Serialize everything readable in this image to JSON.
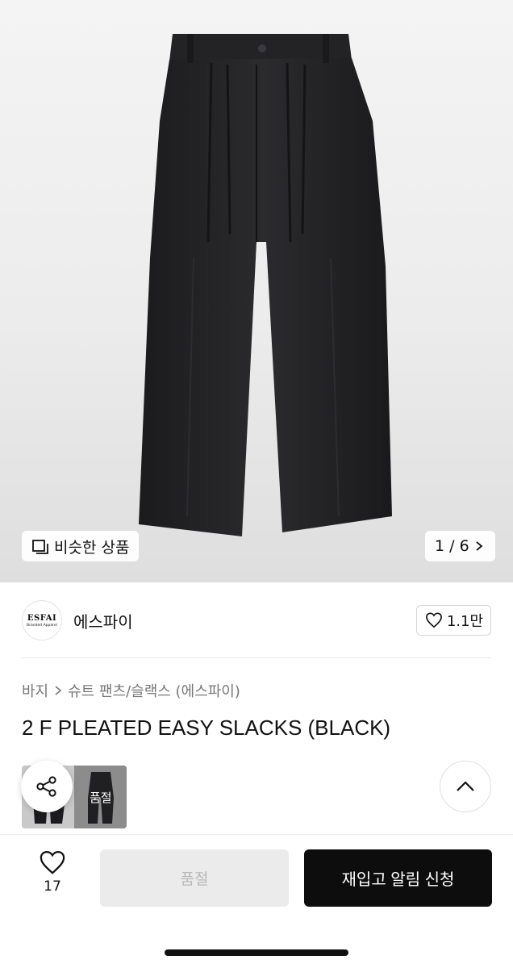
{
  "gallery": {
    "similar_label": "비슷한 상품",
    "pager": "1 / 6",
    "icons": {
      "similar": "similar-products-icon",
      "next": "chevron-right-icon"
    }
  },
  "seller": {
    "logo_line1": "ESFAI",
    "logo_line2": "Branded Apparel",
    "name": "에스파이",
    "likes": "1.1만"
  },
  "breadcrumb": {
    "level1": "바지",
    "level2": "슈트 팬츠/슬랙스 (에스파이)"
  },
  "product": {
    "title": "2 F PLEATED EASY SLACKS (BLACK)"
  },
  "thumbnails": {
    "second_label": "품절"
  },
  "bottom_bar": {
    "like_count": "17",
    "soldout_label": "품절",
    "restock_label": "재입고 알림 신청"
  },
  "colors": {
    "primary_button": "#0d0d0d",
    "disabled_button": "#ebebeb",
    "disabled_text": "#b8b8b8",
    "breadcrumb_text": "#777777"
  }
}
